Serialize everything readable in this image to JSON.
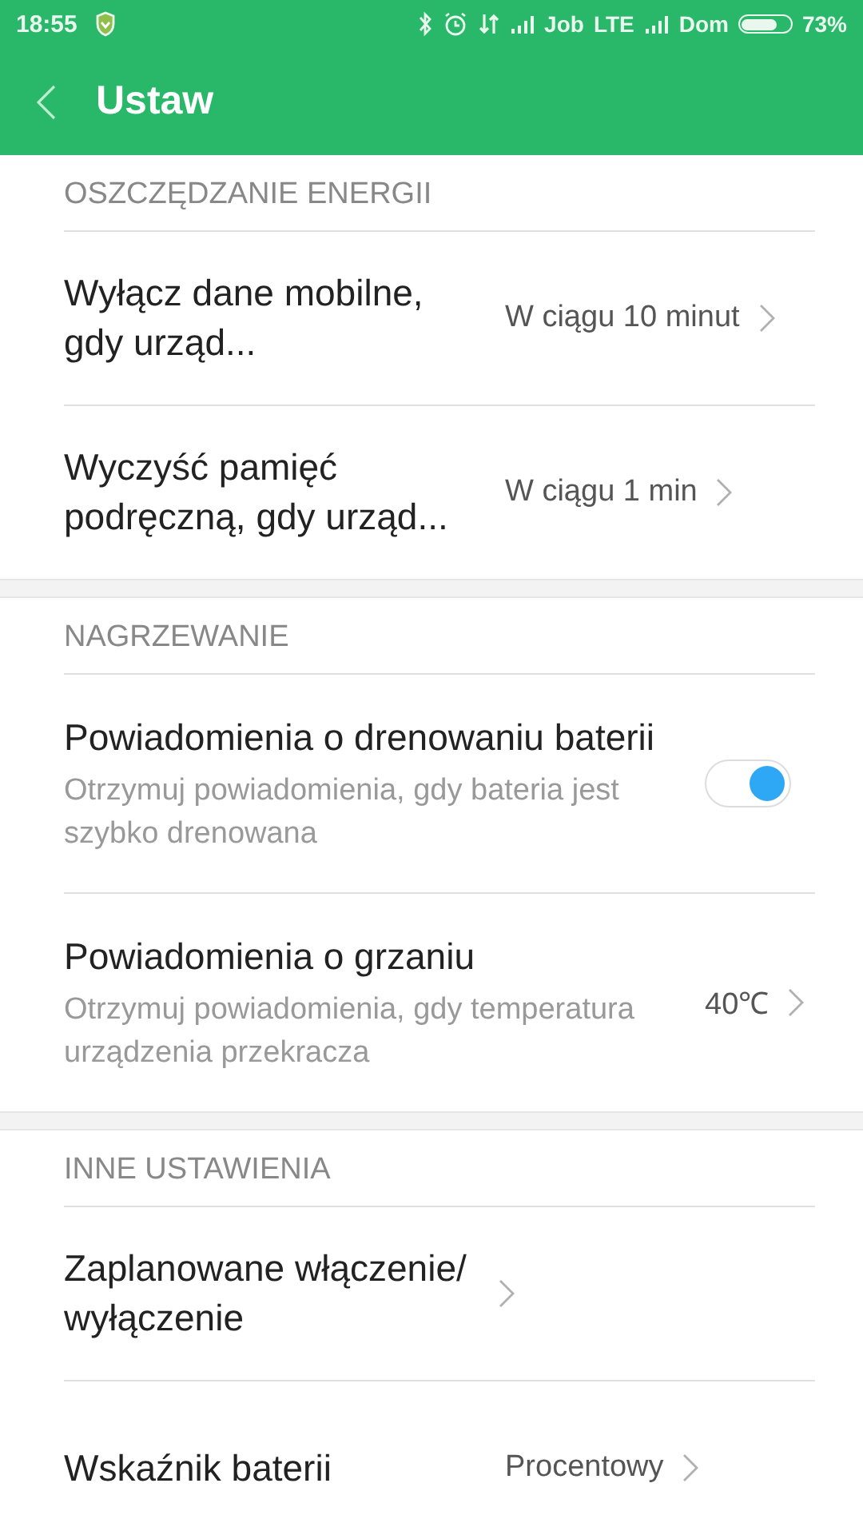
{
  "status_bar": {
    "time": "18:55",
    "carrier_1": "Job",
    "network_1": "LTE",
    "carrier_2": "Dom",
    "battery_percent": "73%"
  },
  "header": {
    "title": "Ustaw"
  },
  "sections": [
    {
      "title": "OSZCZĘDZANIE ENERGII",
      "items": [
        {
          "kind": "link",
          "title": "Wyłącz dane mobilne, gdy urząd...",
          "value": "W ciągu 10 minut"
        },
        {
          "kind": "link",
          "title": "Wyczyść pamięć podręczną, gdy urząd...",
          "value": "W ciągu 1 min"
        }
      ]
    },
    {
      "title": "NAGRZEWANIE",
      "items": [
        {
          "kind": "toggle",
          "title": "Powiadomienia o drenowaniu baterii",
          "subtitle": "Otrzymuj powiadomienia, gdy bateria jest szybko drenowana",
          "on": true
        },
        {
          "kind": "link",
          "title": "Powiadomienia o grzaniu",
          "subtitle": "Otrzymuj powiadomienia, gdy temperatura urządzenia przekracza",
          "value": "40℃"
        }
      ]
    },
    {
      "title": "INNE USTAWIENIA",
      "items": [
        {
          "kind": "link",
          "title": "Zaplanowane włączenie/ wyłączenie"
        },
        {
          "kind": "link",
          "title": "Wskaźnik baterii",
          "value": "Procentowy"
        }
      ]
    }
  ]
}
